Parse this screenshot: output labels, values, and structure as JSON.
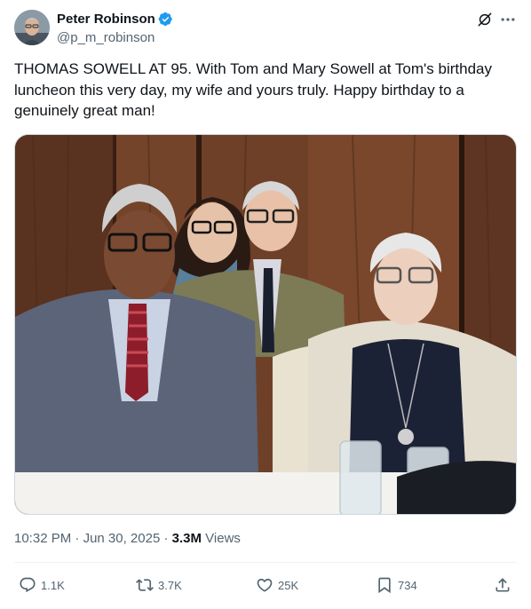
{
  "author": {
    "name": "Peter Robinson",
    "handle": "@p_m_robinson",
    "verified": true,
    "verified_color": "#1d9bf0"
  },
  "header_actions": {
    "grok_icon": "grok-icon",
    "more_icon": "more-horizontal-icon"
  },
  "tweet": {
    "text": "THOMAS SOWELL AT 95. With Tom and Mary Sowell at Tom's birthday luncheon this very day, my wife and yours truly. Happy birthday to a genuinely great man!"
  },
  "meta": {
    "time": "10:32 PM",
    "separator": " · ",
    "date": "Jun 30, 2025",
    "separator2": " · ",
    "views_count": "3.3M",
    "views_label": " Views"
  },
  "actions": {
    "replies": "1.1K",
    "reposts": "3.7K",
    "likes": "25K",
    "bookmarks": "734"
  },
  "colors": {
    "text_primary": "#0f1419",
    "text_secondary": "#536471",
    "divider": "#eff3f4"
  }
}
